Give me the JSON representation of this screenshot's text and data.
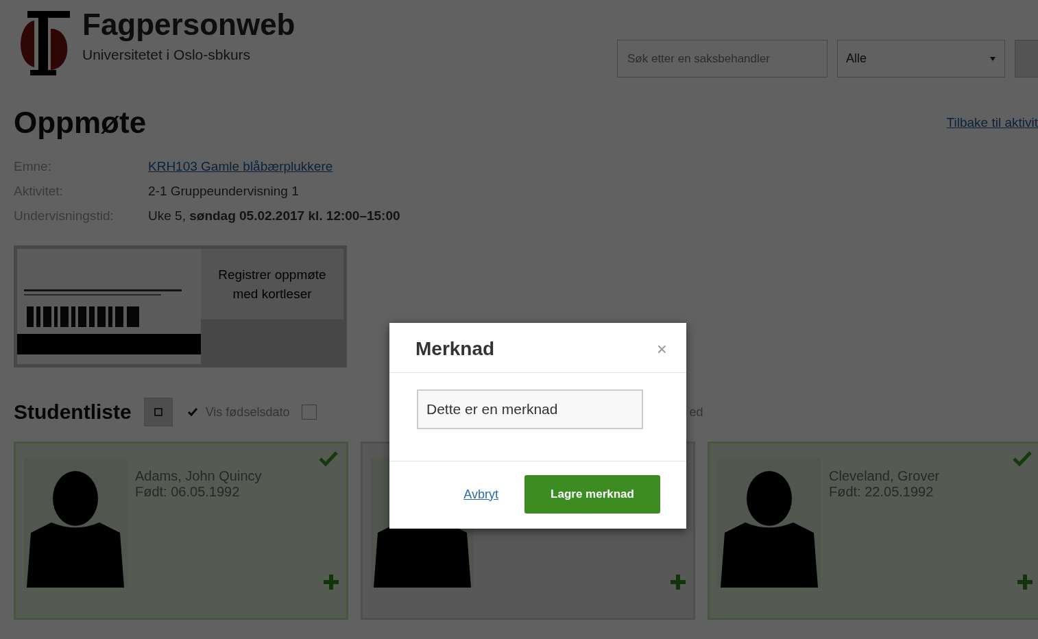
{
  "header": {
    "title": "Fagpersonweb",
    "subtitle": "Universitetet i Oslo-sbkurs",
    "search": {
      "placeholder": "Søk etter en saksbehandler"
    },
    "filter": {
      "value": "Alle"
    }
  },
  "page": {
    "title": "Oppmøte",
    "back_link": "Tilbake til aktivit"
  },
  "details": [
    {
      "label": "Emne:",
      "value": "KRH103 Gamle blåbærplukkere",
      "kind": "link"
    },
    {
      "label": "Aktivitet:",
      "value": "2-1 Gruppeundervisning 1",
      "kind": "text"
    },
    {
      "label": "Undervisningstid:",
      "value": "Uke 5, **søndag 05.02.2017 kl. 12:00–15:00**",
      "kind": "text"
    }
  ],
  "card_reader": {
    "button": "Registrer oppmøte med kortleser"
  },
  "student_list": {
    "title": "Studentliste",
    "options": [
      {
        "label": "Vis fødselsdato",
        "checked": true
      },
      {
        "checked": false
      }
    ],
    "hidden_option_tail": "ed"
  },
  "students": [
    {
      "kind": "full",
      "name": "Adams, John Quincy",
      "born": "Født: 06.05.1992",
      "present": true
    },
    {
      "kind": "covered"
    },
    {
      "kind": "full",
      "name": "Cleveland, Grover",
      "born": "Født: 22.05.1992",
      "present": true
    }
  ],
  "modal": {
    "title": "Merknad",
    "close": "×",
    "input": {
      "value": "Dette er en merknad"
    },
    "cancel": "Avbryt",
    "save": "Lagre merknad"
  }
}
